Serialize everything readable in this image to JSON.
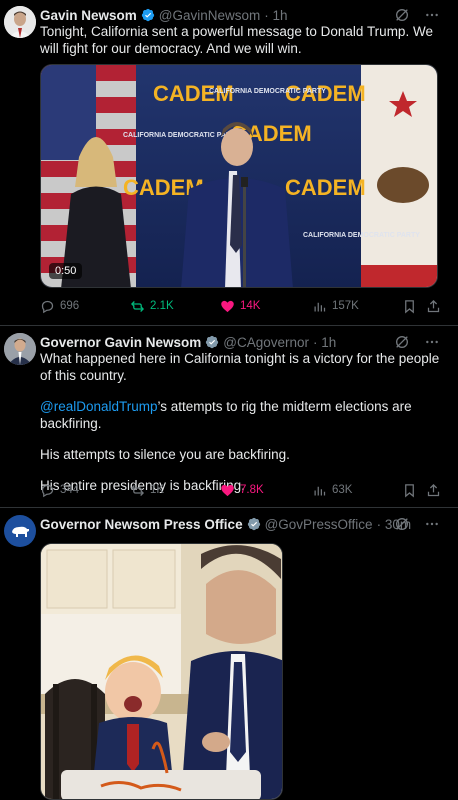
{
  "tweets": [
    {
      "name": "Gavin Newsom",
      "handle": "@GavinNewsom",
      "time": "· 1h",
      "text": "Tonight, California sent a powerful message to Donald Trump. We will fight for our democracy. And we will win.",
      "video_duration": "0:50",
      "signage": {
        "cadem": "CADEM",
        "party": "CALIFORNIA DEMOCRATIC PARTY",
        "flag": "CALIFORNIA REPUBLIC"
      },
      "stats": {
        "replies": "696",
        "reposts": "2.1K",
        "likes": "14K",
        "views": "157K"
      }
    },
    {
      "name": "Governor Gavin Newsom",
      "handle": "@CAgovernor",
      "time": "· 1h",
      "text_line1": "What happened here in California tonight is a victory for the people of this country.",
      "mention": "@realDonaldTrump",
      "text_line2": "’s attempts to rig the midterm elections are backfiring.",
      "text_line3": "His attempts to silence you are backfiring.",
      "text_line4": "His entire presidency is backfiring.",
      "stats": {
        "replies": "344",
        "reposts": "1K",
        "likes": "7.8K",
        "views": "63K"
      }
    },
    {
      "name": "Governor Newsom Press Office",
      "handle": "@GovPressOffice",
      "time": "· 30m"
    }
  ],
  "colors": {
    "accent": "#1d9bf0",
    "repost": "#00ba7c",
    "like": "#f91880",
    "muted": "#71767b"
  },
  "icons": [
    "verified-badge-icon",
    "gov-badge-icon",
    "grok-icon",
    "more-icon",
    "reply-icon",
    "repost-icon",
    "like-icon",
    "views-icon",
    "bookmark-icon",
    "share-icon"
  ]
}
